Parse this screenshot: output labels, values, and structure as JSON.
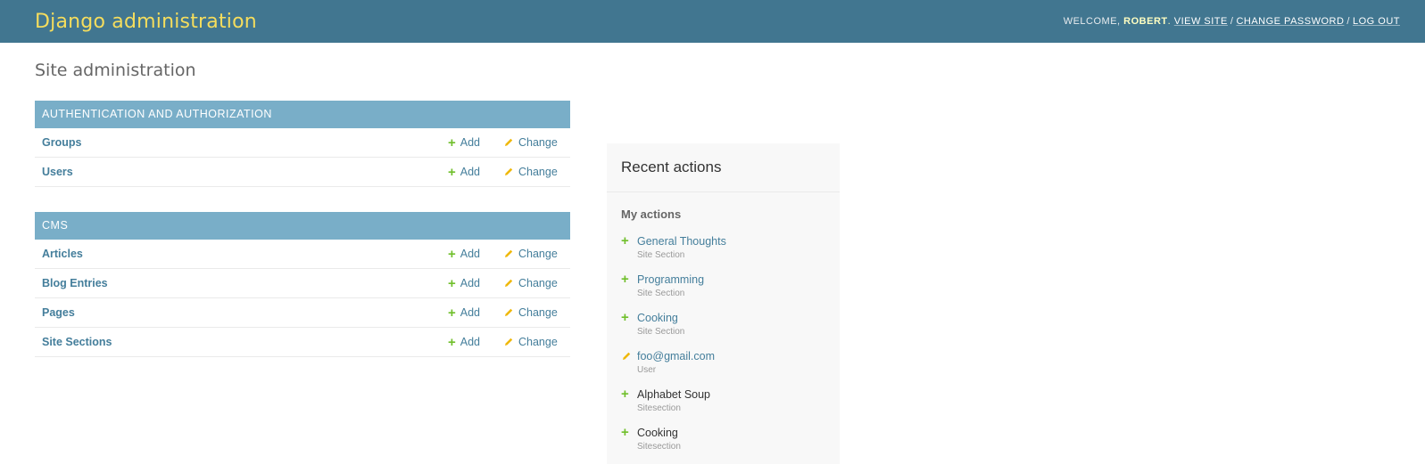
{
  "header": {
    "branding": "Django administration",
    "welcome": "Welcome,",
    "username": "Robert",
    "links": [
      "View site",
      "Change password",
      "Log out"
    ]
  },
  "page_title": "Site administration",
  "apps": [
    {
      "caption": "Authentication and Authorization",
      "models": [
        {
          "name": "Groups",
          "add": "Add",
          "change": "Change"
        },
        {
          "name": "Users",
          "add": "Add",
          "change": "Change"
        }
      ]
    },
    {
      "caption": "CMS",
      "models": [
        {
          "name": "Articles",
          "add": "Add",
          "change": "Change"
        },
        {
          "name": "Blog Entries",
          "add": "Add",
          "change": "Change"
        },
        {
          "name": "Pages",
          "add": "Add",
          "change": "Change"
        },
        {
          "name": "Site Sections",
          "add": "Add",
          "change": "Change"
        }
      ]
    }
  ],
  "recent": {
    "title": "Recent actions",
    "subtitle": "My actions",
    "items": [
      {
        "name": "General Thoughts",
        "type": "Site Section",
        "action": "add",
        "linked": true
      },
      {
        "name": "Programming",
        "type": "Site Section",
        "action": "add",
        "linked": true
      },
      {
        "name": "Cooking",
        "type": "Site Section",
        "action": "add",
        "linked": true
      },
      {
        "name": "foo@gmail.com",
        "type": "User",
        "action": "change",
        "linked": true
      },
      {
        "name": "Alphabet Soup",
        "type": "Sitesection",
        "action": "add",
        "linked": false
      },
      {
        "name": "Cooking",
        "type": "Sitesection",
        "action": "add",
        "linked": false
      }
    ]
  },
  "colors": {
    "header_bg": "#417690",
    "branding": "#f5dd5d",
    "module_caption": "#79aec8",
    "link": "#447e9b",
    "add_icon": "#70bf2b",
    "change_icon": "#efb80b"
  }
}
